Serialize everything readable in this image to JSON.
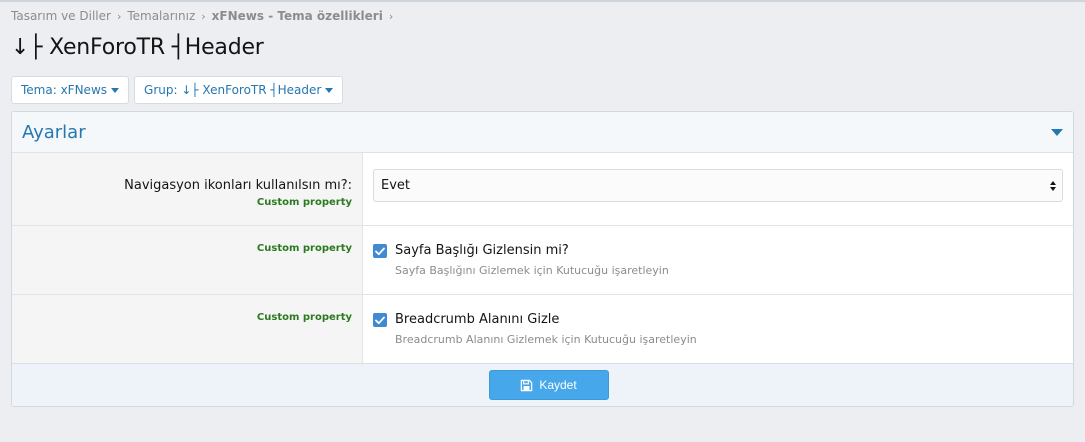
{
  "breadcrumb": {
    "items": [
      "Tasarım ve Diller",
      "Temalarınız",
      "xFNews - Tema özellikleri"
    ],
    "separator": "›"
  },
  "page": {
    "title": "↓├ XenForoTR ┤Header"
  },
  "filters": {
    "theme_label": "Tema: xFNews",
    "group_label": "Grup: ↓├ XenForoTR ┤Header"
  },
  "block": {
    "title": "Ayarlar",
    "rows": [
      {
        "label": "Navigasyon ikonları kullanılsın mı?:",
        "tag": "Custom property",
        "select_value": "Evet"
      },
      {
        "tag": "Custom property",
        "checkbox_label": "Sayfa Başlığı Gizlensin mi?",
        "hint": "Sayfa Başlığını Gizlemek için Kutucuğu işaretleyin",
        "checked": true
      },
      {
        "tag": "Custom property",
        "checkbox_label": "Breadcrumb Alanını Gizle",
        "hint": "Breadcrumb Alanını Gizlemek için Kutucuğu işaretleyin",
        "checked": true
      }
    ],
    "save_label": "Kaydet"
  },
  "colors": {
    "accent": "#2577b1",
    "custom_property": "#2b7a1f",
    "save_button": "#47a7eb"
  },
  "icons": [
    "chevron-right-icon",
    "caret-down-icon",
    "collapse-toggle-icon",
    "select-arrows-icon",
    "checkbox-checked-icon",
    "save-disk-icon"
  ]
}
